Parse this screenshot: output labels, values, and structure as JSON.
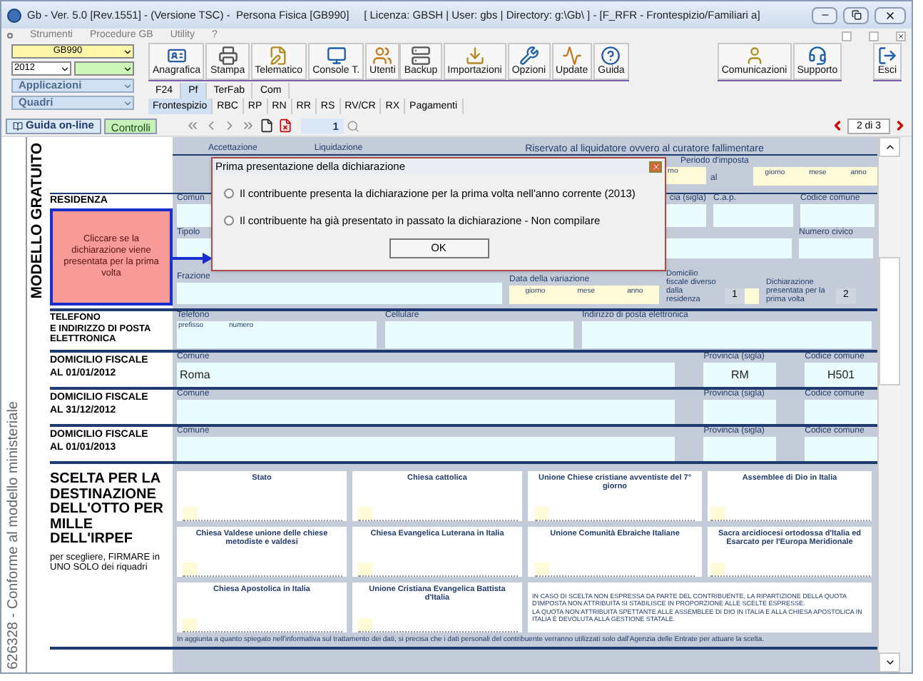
{
  "window": {
    "title": "Gb - Ver. 5.0 [Rev.1551] - (Versione TSC) -  Persona Fisica [GB990]     [ Licenza: GBSH | User: gbs | Directory: g:\\Gb\\ ] - [F_RFR - Frontespizio/Familiari a]"
  },
  "menu": [
    "Strumenti",
    "Procedure GB",
    "Utility",
    "?"
  ],
  "selectors": {
    "product": "GB990",
    "year": "2012",
    "applications": "Applicazioni",
    "sections": "Quadri"
  },
  "toolbar_groups": [
    [
      "Anagrafica",
      "Stampa",
      "Telematico",
      "Console T.",
      "Utenti"
    ],
    [
      "Backup",
      "Importazioni",
      "Opzioni",
      "Update",
      "Guida"
    ],
    [
      "Comunicazioni",
      "Supporto"
    ],
    [
      "Esci"
    ]
  ],
  "tabs": [
    {
      "label": "F24",
      "selected": false
    },
    {
      "label": "Pf",
      "selected": true
    },
    {
      "label": "TerFab",
      "selected": false
    },
    {
      "label": "Com",
      "selected": false
    }
  ],
  "subtabs": [
    {
      "label": "Frontespizio",
      "selected": true
    },
    {
      "label": "RBC",
      "selected": false
    },
    {
      "label": "RP",
      "selected": false
    },
    {
      "label": "RN",
      "selected": false
    },
    {
      "label": "RR",
      "selected": false
    },
    {
      "label": "RS",
      "selected": false
    },
    {
      "label": "RV/CR",
      "selected": false
    },
    {
      "label": "RX",
      "selected": false
    },
    {
      "label": "Pagamenti",
      "selected": false
    }
  ],
  "nav": {
    "help": "Guida on-line",
    "check": "Controlli",
    "page": "1",
    "pages": "2 di 3"
  },
  "side_note": "626328 - Conforme al modello ministeriale",
  "model_title": "MODELLO GRATUITO",
  "header": {
    "labels": [
      "Accettazione",
      "Liquidazione"
    ],
    "reserved": "Riservato al liquidatore ovvero al curatore fallimentare",
    "period": "Periodo d'imposta",
    "from_part": "rno",
    "to": "al",
    "date_parts": [
      "giorno",
      "mese",
      "anno"
    ]
  },
  "residence": {
    "title": "RESIDENZA",
    "hint": "Cliccare se la dichiarazione viene presentata per la prima volta",
    "municipality": "Comun",
    "province": "cia (sigla)",
    "postcode": "C.a.p.",
    "code": "Codice comune",
    "type": "Tipolo",
    "number": "Numero civico",
    "hamlet": "Frazione",
    "change_date": "Data della variazione",
    "date_parts": [
      "giorno",
      "mese",
      "anno"
    ],
    "fiscal_label": "Domicilio fiscale diverso dalla residenza",
    "fiscal_value": "1",
    "first_label": "Dichiarazione presentata per la prima volta",
    "first_value": "2"
  },
  "contacts": {
    "title": [
      "TELEFONO",
      "E INDIRIZZO DI POSTA",
      "ELETTRONICA"
    ],
    "phone": "Telefono",
    "prefix": "prefisso",
    "number": "numero",
    "mobile": "Cellulare",
    "email": "Indirizzo di posta elettronica"
  },
  "domiciles": [
    {
      "title": [
        "DOMICILIO FISCALE",
        "AL 01/01/2012"
      ],
      "municipality_label": "Comune",
      "municipality": "Roma",
      "province_label": "Provincia (sigla)",
      "province": "RM",
      "code_label": "Codice comune",
      "code": "H501"
    },
    {
      "title": [
        "DOMICILIO FISCALE",
        "AL 31/12/2012"
      ],
      "municipality_label": "Comune",
      "province_label": "Provincia (sigla)",
      "code_label": "Codice comune"
    },
    {
      "title": [
        "DOMICILIO FISCALE",
        "AL 01/01/2013"
      ],
      "municipality_label": "Comune",
      "province_label": "Provincia (sigla)",
      "code_label": "Codice comune"
    }
  ],
  "choice": {
    "title": "SCELTA PER LA DESTINAZIONE DELL'OTTO PER MILLE DELL'IRPEF",
    "subtitle": "per scegliere, FIRMARE in UNO SOLO dei riquadri",
    "options": [
      "Stato",
      "Chiesa cattolica",
      "Unione Chiese cristiane avventiste del 7° giorno",
      "Assemblee di Dio in Italia",
      "Chiesa Valdese unione delle chiese metodiste e valdesi",
      "Chiesa Evangelica Luterana in Italia",
      "Unione Comunità Ebraiche Italiane",
      "Sacra arcidiocesi ortodossa d'Italia ed Esarcato per l'Europa Meridionale",
      "Chiesa Apostolica in Italia",
      "Unione Cristiana Evangelica Battista d'Italia"
    ],
    "note": [
      "IN CASO DI SCELTA NON ESPRESSA DA PARTE DEL CONTRIBUENTE, LA RIPARTIZIONE DELLA QUOTA D'IMPOSTA NON ATTRIBUITA SI STABILISCE IN PROPORZIONE ALLE SCELTE ESPRESSE.",
      "LA QUOTA NON ATTRIBUITA SPETTANTE ALLE ASSEMBLEE DI DIO IN ITALIA E ALLA CHIESA APOSTOLICA IN ITALIA È DEVOLUTA ALLA GESTIONE STATALE."
    ],
    "footer": "In aggiunta a quanto spiegato nell'informativa sul trattamento dei dati, si precisa che i dati personali del contribuente verranno utilizzati solo dall'Agenzia delle Entrate per attuare la scelta."
  },
  "dialog": {
    "title": "Prima presentazione della dichiarazione",
    "options": [
      {
        "label": "Il contribuente presenta la dichiarazione per la prima volta nell'anno corrente (2013)",
        "selected": false
      },
      {
        "label": "Il contribuente ha già presentato in passato la dichiarazione - Non compilare",
        "selected": false
      }
    ],
    "button": "OK"
  }
}
